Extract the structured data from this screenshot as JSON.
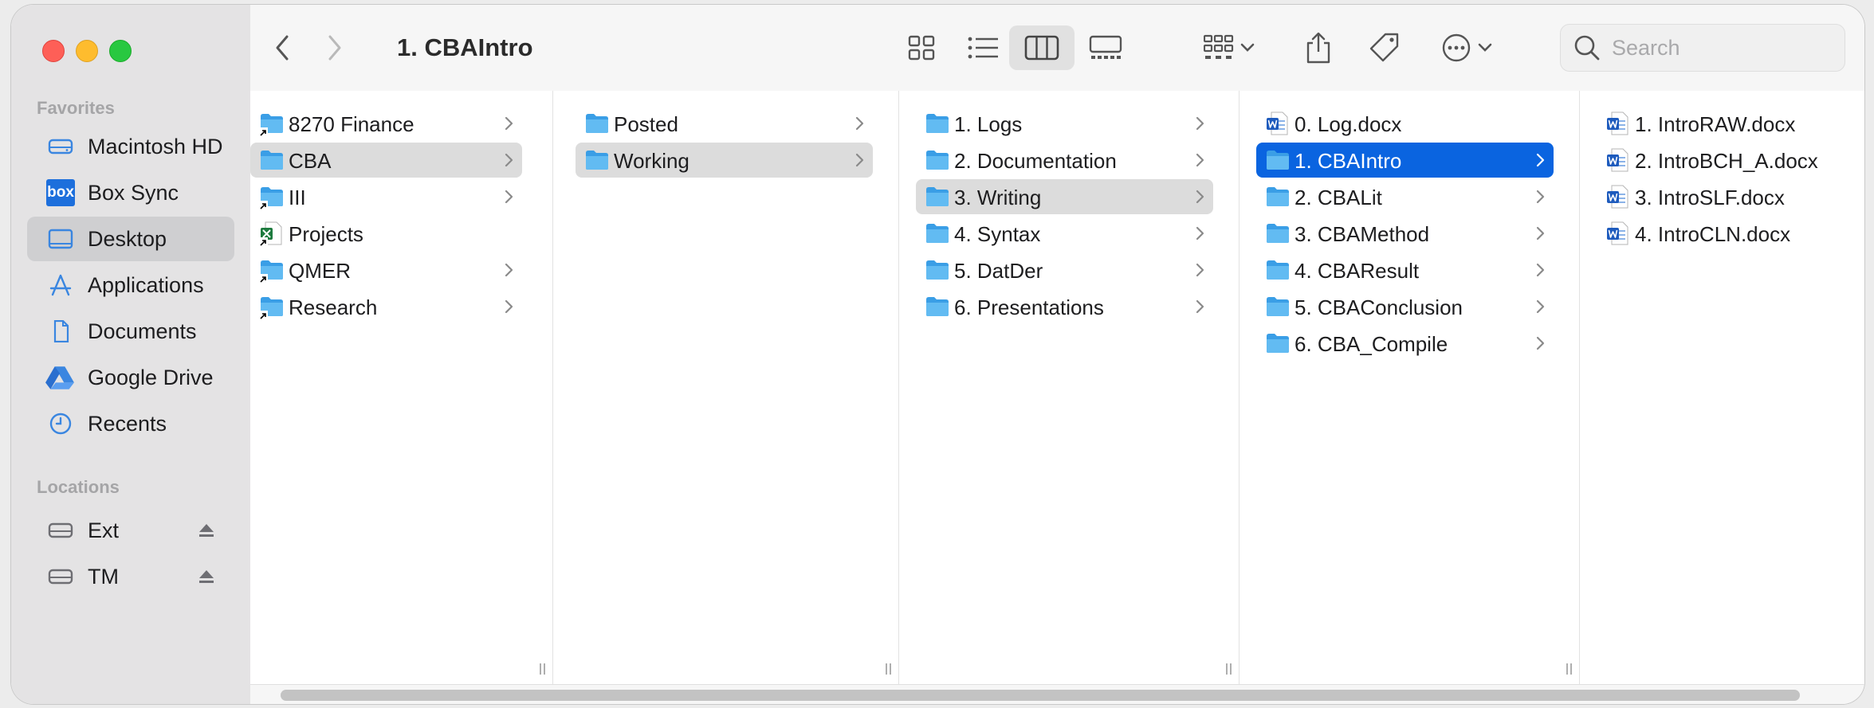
{
  "window": {
    "title": "1. CBAIntro"
  },
  "sidebar": {
    "favorites_label": "Favorites",
    "favorites": [
      {
        "label": "Macintosh HD",
        "icon": "internal-drive-icon",
        "selected": false
      },
      {
        "label": "Box Sync",
        "icon": "box-logo-icon",
        "selected": false
      },
      {
        "label": "Desktop",
        "icon": "desktop-icon",
        "selected": true
      },
      {
        "label": "Applications",
        "icon": "applications-icon",
        "selected": false
      },
      {
        "label": "Documents",
        "icon": "document-icon",
        "selected": false
      },
      {
        "label": "Google Drive",
        "icon": "google-drive-icon",
        "selected": false
      },
      {
        "label": "Recents",
        "icon": "clock-icon",
        "selected": false
      }
    ],
    "locations_label": "Locations",
    "locations": [
      {
        "label": "Ext",
        "icon": "external-drive-icon",
        "eject": true
      },
      {
        "label": "TM",
        "icon": "external-drive-icon",
        "eject": true
      }
    ],
    "box_badge": "box"
  },
  "toolbar": {
    "search_placeholder": "Search",
    "icons": [
      "back-icon",
      "forward-icon",
      "icon-view-icon",
      "list-view-icon",
      "column-view-icon",
      "gallery-view-icon",
      "group-icon",
      "share-icon",
      "tag-icon",
      "more-icon"
    ]
  },
  "columns": [
    {
      "items": [
        {
          "name": "8270 Finance",
          "type": "folder-alias",
          "chevron": true,
          "state": ""
        },
        {
          "name": "CBA",
          "type": "folder",
          "chevron": true,
          "state": "hl"
        },
        {
          "name": "III",
          "type": "folder-alias",
          "chevron": true,
          "state": ""
        },
        {
          "name": "Projects",
          "type": "excel-alias",
          "chevron": false,
          "state": ""
        },
        {
          "name": "QMER",
          "type": "folder-alias",
          "chevron": true,
          "state": ""
        },
        {
          "name": "Research",
          "type": "folder-alias",
          "chevron": true,
          "state": ""
        }
      ]
    },
    {
      "items": [
        {
          "name": "Posted",
          "type": "folder",
          "chevron": true,
          "state": ""
        },
        {
          "name": "Working",
          "type": "folder",
          "chevron": true,
          "state": "hl"
        }
      ]
    },
    {
      "items": [
        {
          "name": "1. Logs",
          "type": "folder",
          "chevron": true,
          "state": ""
        },
        {
          "name": "2. Documentation",
          "type": "folder",
          "chevron": true,
          "state": ""
        },
        {
          "name": "3. Writing",
          "type": "folder",
          "chevron": true,
          "state": "hl"
        },
        {
          "name": "4. Syntax",
          "type": "folder",
          "chevron": true,
          "state": ""
        },
        {
          "name": "5. DatDer",
          "type": "folder",
          "chevron": true,
          "state": ""
        },
        {
          "name": "6. Presentations",
          "type": "folder",
          "chevron": true,
          "state": ""
        }
      ]
    },
    {
      "items": [
        {
          "name": "0. Log.docx",
          "type": "word",
          "chevron": false,
          "state": ""
        },
        {
          "name": "1. CBAIntro",
          "type": "folder",
          "chevron": true,
          "state": "sel"
        },
        {
          "name": "2. CBALit",
          "type": "folder",
          "chevron": true,
          "state": ""
        },
        {
          "name": "3. CBAMethod",
          "type": "folder",
          "chevron": true,
          "state": ""
        },
        {
          "name": "4. CBAResult",
          "type": "folder",
          "chevron": true,
          "state": ""
        },
        {
          "name": "5. CBAConclusion",
          "type": "folder",
          "chevron": true,
          "state": ""
        },
        {
          "name": "6. CBA_Compile",
          "type": "folder",
          "chevron": true,
          "state": ""
        }
      ]
    },
    {
      "items": [
        {
          "name": "1. IntroRAW.docx",
          "type": "word",
          "chevron": false,
          "state": ""
        },
        {
          "name": "2. IntroBCH_A.docx",
          "type": "word",
          "chevron": false,
          "state": ""
        },
        {
          "name": "3. IntroSLF.docx",
          "type": "word",
          "chevron": false,
          "state": ""
        },
        {
          "name": "4. IntroCLN.docx",
          "type": "word",
          "chevron": false,
          "state": ""
        }
      ]
    }
  ],
  "colors": {
    "accent": "#0a64e0",
    "folder": "#5ab4f0",
    "folder_dark": "#3a9ee6"
  }
}
